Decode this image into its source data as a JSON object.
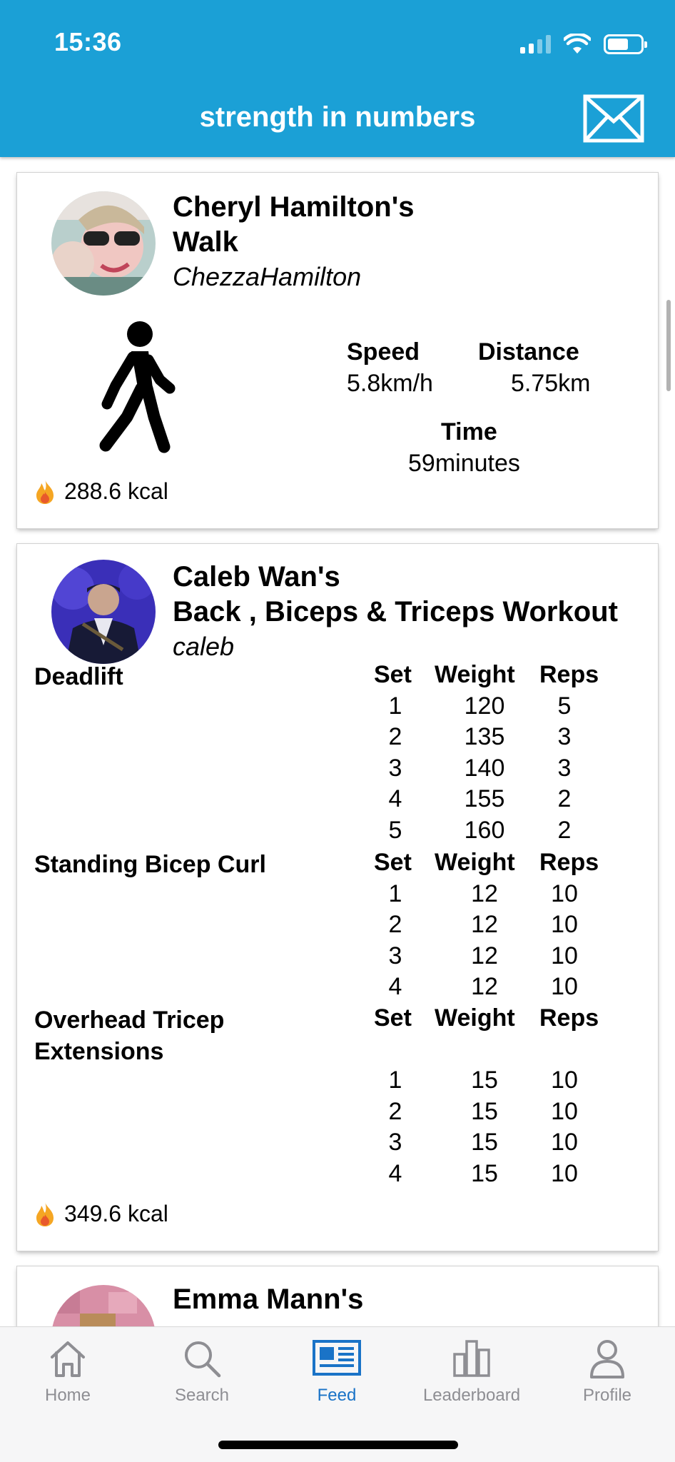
{
  "status_bar": {
    "time": "15:36"
  },
  "header": {
    "title": "strength in numbers"
  },
  "posts": [
    {
      "title_line1": "Cheryl Hamilton's",
      "title_line2": "Walk",
      "username": "ChezzaHamilton",
      "activity_icon": "walking-person-icon",
      "stats": {
        "speed_label": "Speed",
        "speed_value": "5.8km/h",
        "distance_label": "Distance",
        "distance_value": "5.75km",
        "time_label": "Time",
        "time_value": "59minutes"
      },
      "kcal": "288.6 kcal"
    },
    {
      "title_line1": "Caleb Wan's",
      "title_line2": "Back , Biceps & Triceps Workout",
      "username": "caleb",
      "columns": {
        "set": "Set",
        "weight": "Weight",
        "reps": "Reps"
      },
      "exercises": [
        {
          "name": "Deadlift",
          "sets": [
            {
              "set": "1",
              "weight": "120",
              "reps": "5"
            },
            {
              "set": "2",
              "weight": "135",
              "reps": "3"
            },
            {
              "set": "3",
              "weight": "140",
              "reps": "3"
            },
            {
              "set": "4",
              "weight": "155",
              "reps": "2"
            },
            {
              "set": "5",
              "weight": "160",
              "reps": "2"
            }
          ]
        },
        {
          "name": "Standing Bicep Curl",
          "sets": [
            {
              "set": "1",
              "weight": "12",
              "reps": "10"
            },
            {
              "set": "2",
              "weight": "12",
              "reps": "10"
            },
            {
              "set": "3",
              "weight": "12",
              "reps": "10"
            },
            {
              "set": "4",
              "weight": "12",
              "reps": "10"
            }
          ]
        },
        {
          "name": "Overhead Tricep Extensions",
          "sets": [
            {
              "set": "1",
              "weight": "15",
              "reps": "10"
            },
            {
              "set": "2",
              "weight": "15",
              "reps": "10"
            },
            {
              "set": "3",
              "weight": "15",
              "reps": "10"
            },
            {
              "set": "4",
              "weight": "15",
              "reps": "10"
            }
          ]
        }
      ],
      "kcal": "349.6 kcal"
    },
    {
      "title_line1": "Emma Mann's"
    }
  ],
  "tabbar": {
    "items": [
      {
        "label": "Home",
        "icon": "home-icon"
      },
      {
        "label": "Search",
        "icon": "search-icon"
      },
      {
        "label": "Feed",
        "icon": "newspaper-icon"
      },
      {
        "label": "Leaderboard",
        "icon": "bar-chart-icon"
      },
      {
        "label": "Profile",
        "icon": "person-icon"
      }
    ],
    "active": "Feed"
  },
  "colors": {
    "header_bg": "#1ba0d6",
    "tab_active": "#1a73c7",
    "tab_inactive": "#8e8e93",
    "flame": "#f5a623"
  }
}
